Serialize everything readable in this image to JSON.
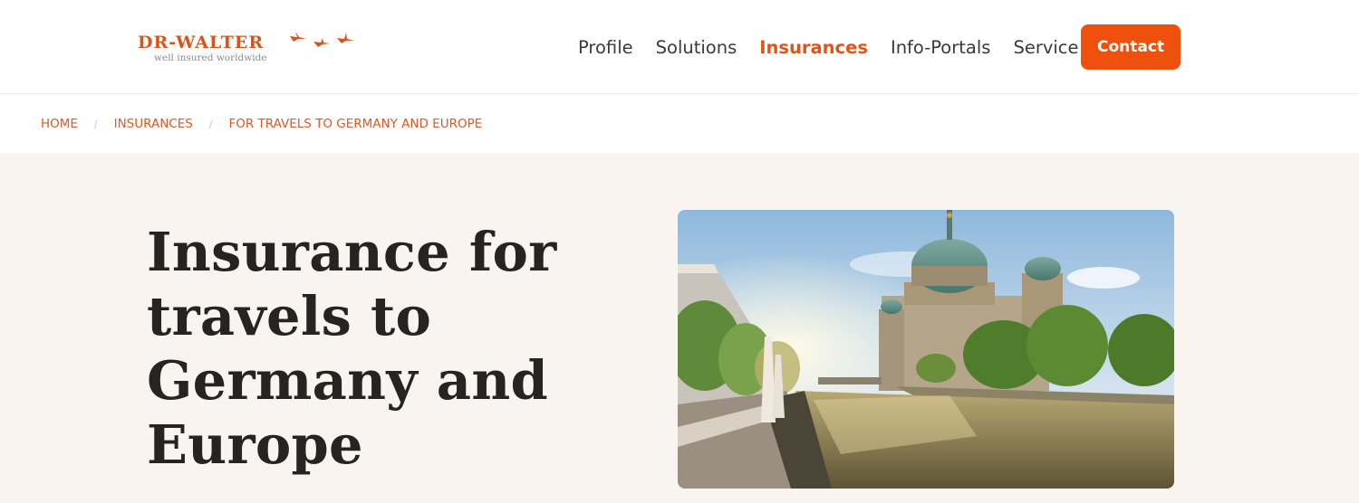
{
  "brand": {
    "name": "DR-WALTER",
    "tagline": "well insured worldwide",
    "accent_color": "#f0500e"
  },
  "nav": {
    "items": [
      {
        "label": "Profile",
        "active": false
      },
      {
        "label": "Solutions",
        "active": false
      },
      {
        "label": "Insurances",
        "active": true
      },
      {
        "label": "Info-Portals",
        "active": false
      },
      {
        "label": "Service",
        "active": false
      }
    ],
    "contact_label": "Contact"
  },
  "breadcrumb": {
    "items": [
      "HOME",
      "INSURANCES",
      "FOR TRAVELS TO GERMANY AND EUROPE"
    ],
    "separator": "/"
  },
  "hero": {
    "title": "Insurance for travels to Germany and Europe",
    "image_icon": "berlin-cathedral-photo"
  }
}
